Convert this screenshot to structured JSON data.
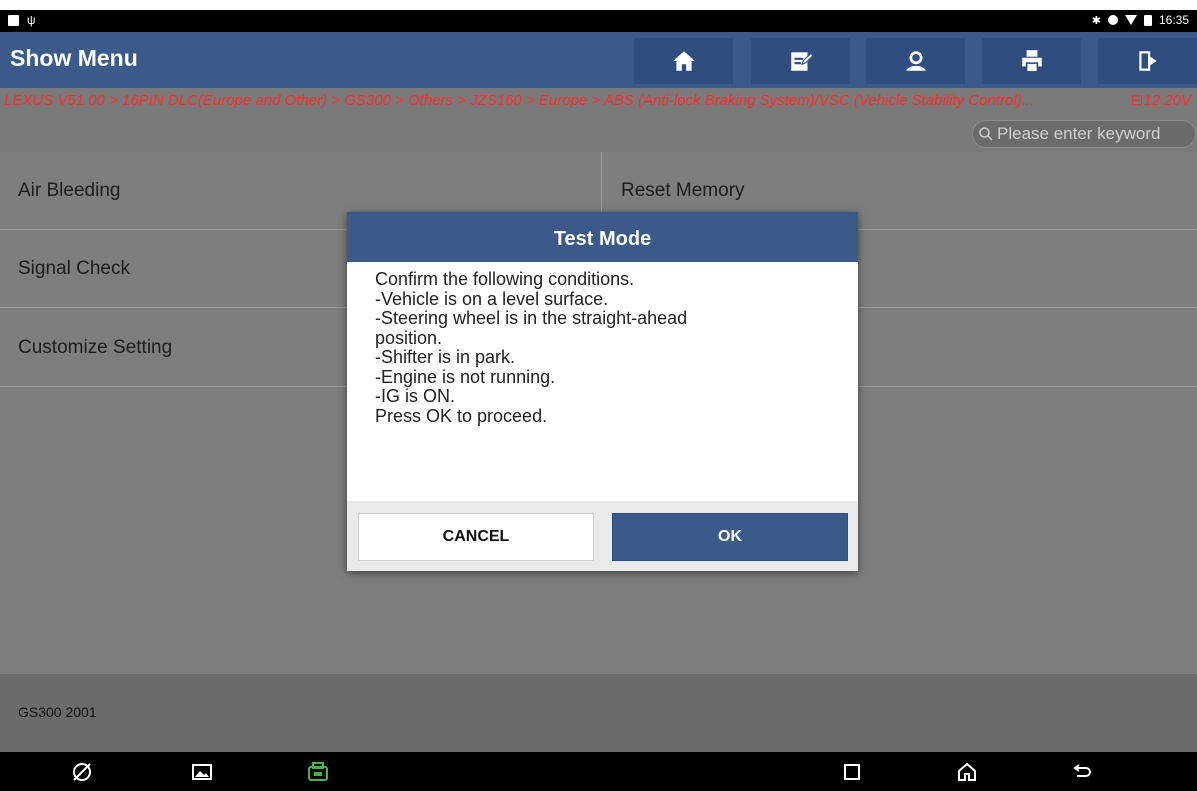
{
  "statusbar": {
    "time": "16:35"
  },
  "app": {
    "title": "Show Menu"
  },
  "toolbar": [
    {
      "name": "home-button",
      "icon": "home-icon"
    },
    {
      "name": "edit-button",
      "icon": "edit-icon"
    },
    {
      "name": "user-button",
      "icon": "user-icon"
    },
    {
      "name": "print-button",
      "icon": "print-icon"
    },
    {
      "name": "exit-button",
      "icon": "exit-icon"
    }
  ],
  "breadcrumb": {
    "text": "LEXUS V51.00 > 16PIN DLC(Europe and Other) > GS300 > Others > JZS160 > Europe > ABS (Anti-lock Braking System)/VSC (Vehicle Stability Control)...",
    "voltage": "12.20V"
  },
  "search": {
    "placeholder": "Please enter keyword"
  },
  "menu": {
    "items": [
      "Air Bleeding",
      "Reset Memory",
      "Signal Check",
      "Customize Setting"
    ]
  },
  "footer": {
    "vehicle": "GS300 2001"
  },
  "dialog": {
    "title": "Test Mode",
    "lines": [
      "Confirm the following conditions.",
      "-Vehicle is on a level surface.",
      "-Steering wheel is in the straight-ahead",
      "position.",
      "-Shifter is in park.",
      "-Engine is not running.",
      "-IG is ON.",
      "Press OK to proceed."
    ],
    "cancel_label": "CANCEL",
    "ok_label": "OK"
  },
  "colors": {
    "header": "#3b5a8a",
    "breadcrumb_text": "#ff2a2a",
    "content_bg": "#7e7e7e"
  }
}
